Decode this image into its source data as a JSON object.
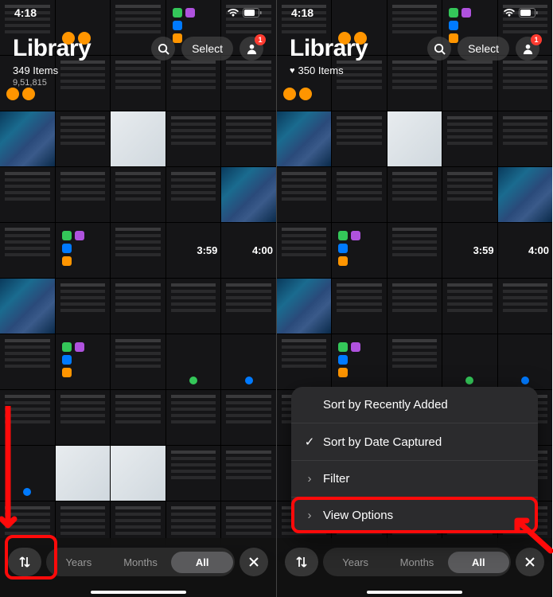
{
  "status": {
    "time": "4:18"
  },
  "left": {
    "title": "Library",
    "item_count": "349 Items",
    "subvalue": "9,51,815",
    "select_label": "Select",
    "badge": "1",
    "toolbar": {
      "years": "Years",
      "months": "Months",
      "all": "All"
    },
    "thumb_time1": "3:59",
    "thumb_time2": "4:00"
  },
  "right": {
    "title": "Library",
    "item_count": "350 Items",
    "select_label": "Select",
    "badge": "1",
    "toolbar": {
      "years": "Years",
      "months": "Months",
      "all": "All"
    },
    "thumb_time1": "3:59",
    "thumb_time2": "4:00",
    "menu": {
      "sort_recent": "Sort by Recently Added",
      "sort_date": "Sort by Date Captured",
      "filter": "Filter",
      "view_options": "View Options"
    }
  }
}
